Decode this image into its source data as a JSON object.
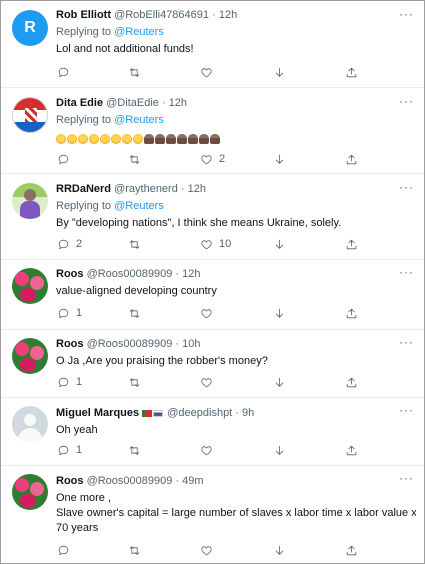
{
  "tweets": [
    {
      "name": "Rob Elliott",
      "handle": "@RobElli47864691",
      "dot": "·",
      "time": "12h",
      "replying_prefix": "Replying to ",
      "replying_to": "@Reuters",
      "text": "Lol and not additional funds!",
      "avatar": {
        "type": "letter",
        "letter": "R",
        "color": "#1d9bf0"
      },
      "counts": {
        "reply": "",
        "retweet": "",
        "like": ""
      }
    },
    {
      "name": "Dita Edie",
      "handle": "@DitaEdie",
      "dot": "·",
      "time": "12h",
      "replying_prefix": "Replying to ",
      "replying_to": "@Reuters",
      "text": "",
      "emoji_sequence": [
        "rofl",
        "rofl",
        "rofl",
        "rofl",
        "rofl",
        "rofl",
        "rofl",
        "rofl",
        "poop",
        "poop",
        "poop",
        "poop",
        "poop",
        "poop",
        "poop"
      ],
      "avatar": {
        "type": "image",
        "color": "#c62828"
      },
      "counts": {
        "reply": "",
        "retweet": "",
        "like": "2"
      }
    },
    {
      "name": "RRDaNerd",
      "handle": "@raythenerd",
      "dot": "·",
      "time": "12h",
      "replying_prefix": "Replying to ",
      "replying_to": "@Reuters",
      "text": "By \"developing nations\", I think she means Ukraine, solely.",
      "avatar": {
        "type": "image",
        "color": "#8bc34a"
      },
      "counts": {
        "reply": "2",
        "retweet": "",
        "like": "10"
      }
    },
    {
      "name": "Roos",
      "handle": "@Roos00089909",
      "dot": "·",
      "time": "12h",
      "text": "value-aligned developing country",
      "avatar": {
        "type": "image",
        "color": "#e91e63"
      },
      "counts": {
        "reply": "1",
        "retweet": "",
        "like": ""
      }
    },
    {
      "name": "Roos",
      "handle": "@Roos00089909",
      "dot": "·",
      "time": "10h",
      "text": "O Ja ,Are you praising the robber's money?",
      "avatar": {
        "type": "image",
        "color": "#e91e63"
      },
      "counts": {
        "reply": "1",
        "retweet": "",
        "like": ""
      }
    },
    {
      "name": "Miguel Marques",
      "handle": "@deepdishpt",
      "dot": "·",
      "time": "9h",
      "text": "Oh yeah",
      "avatar": {
        "type": "default",
        "color": "#cfd9de"
      },
      "counts": {
        "reply": "1",
        "retweet": "",
        "like": ""
      }
    },
    {
      "name": "Roos",
      "handle": "@Roos00089909",
      "dot": "·",
      "time": "49m",
      "text_lines": [
        "One more ,",
        "Slave owner's capital = large number of slaves x labor time x labor value x",
        "70 years"
      ],
      "avatar": {
        "type": "image",
        "color": "#e91e63"
      },
      "counts": {
        "reply": "",
        "retweet": "",
        "like": ""
      }
    }
  ],
  "icons": {
    "more": "more-icon",
    "reply": "reply-icon",
    "retweet": "retweet-icon",
    "like": "heart-icon",
    "downvote": "downvote-icon",
    "share": "share-icon"
  },
  "colors": {
    "accent": "#1d9bf0",
    "text": "#0f1419",
    "muted": "#536471",
    "divider": "#e6ecf0"
  }
}
